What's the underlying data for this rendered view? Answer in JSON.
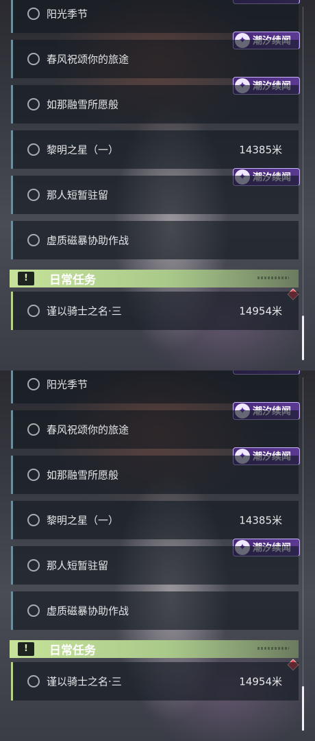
{
  "tasks": [
    {
      "label": "阳光季节",
      "distance": "",
      "badge": ""
    },
    {
      "label": "春风祝颂你的旅途",
      "distance": "",
      "badge": "潮汐续闻"
    },
    {
      "label": "如那融雪所愿般",
      "distance": "",
      "badge": "潮汐续闻"
    },
    {
      "label": "黎明之星（一）",
      "distance": "14385米",
      "badge": ""
    },
    {
      "label": "那人短暂驻留",
      "distance": "",
      "badge": "潮汐续闻"
    },
    {
      "label": "虚质磁暴协助作战",
      "distance": "",
      "badge": ""
    }
  ],
  "daily_section": {
    "title": "日常任务",
    "tasks": [
      {
        "label": "谨以骑士之名·三",
        "distance": "14954米"
      }
    ]
  },
  "icons": {
    "task_status": "circle-outline-icon",
    "badge": "sparkle-star-icon",
    "section": "exclamation-icon",
    "tracking": "red-diamond-marker-icon"
  },
  "colors": {
    "badge_bg": "#5b3a92",
    "section_bg": "#c7e39a",
    "marker": "#e0404a"
  }
}
